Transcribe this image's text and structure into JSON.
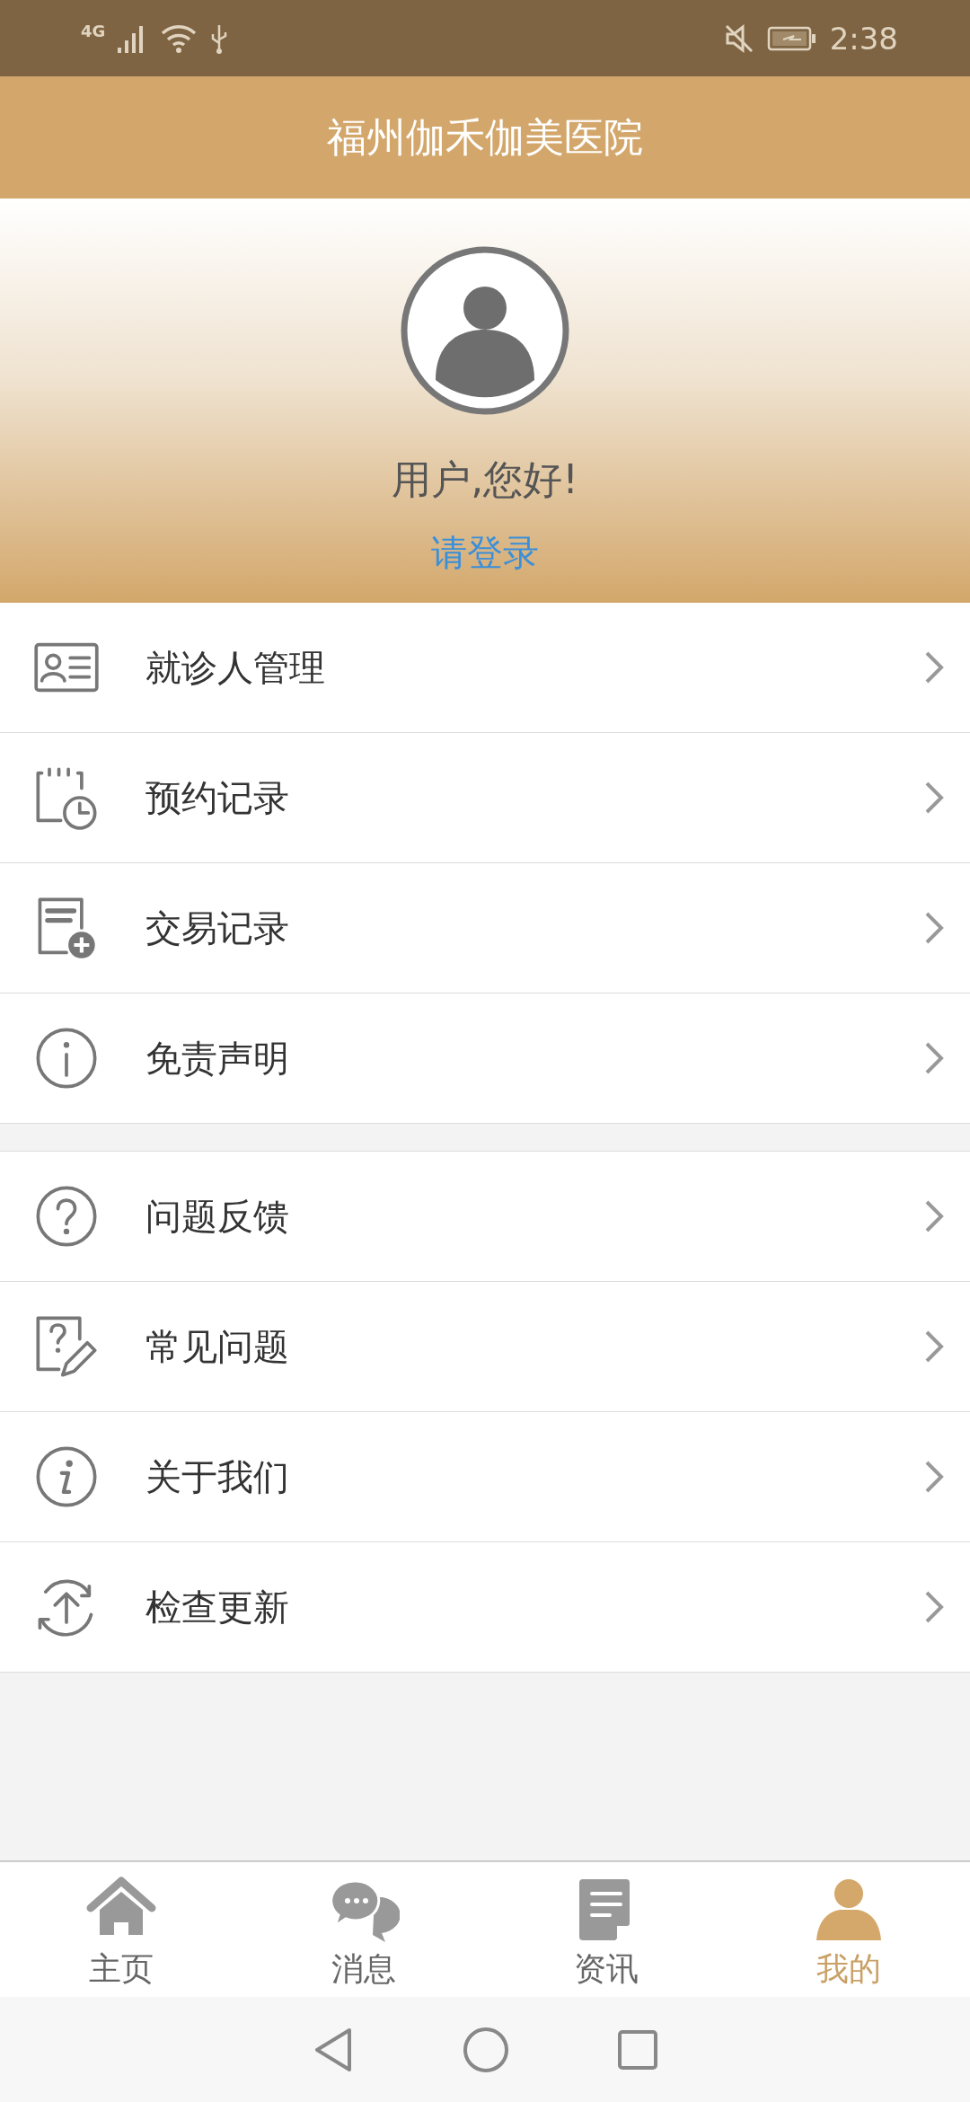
{
  "status_bar": {
    "network": "4G",
    "time": "2:38"
  },
  "header": {
    "title": "福州伽禾伽美医院"
  },
  "profile": {
    "greeting": "用户,您好!",
    "login_link": "请登录"
  },
  "menu_groups": [
    {
      "items": [
        {
          "label": "就诊人管理"
        },
        {
          "label": "预约记录"
        },
        {
          "label": "交易记录"
        },
        {
          "label": "免责声明"
        }
      ]
    },
    {
      "items": [
        {
          "label": "问题反馈"
        },
        {
          "label": "常见问题"
        },
        {
          "label": "关于我们"
        },
        {
          "label": "检查更新"
        }
      ]
    }
  ],
  "tabs": [
    {
      "label": "主页",
      "selected": false
    },
    {
      "label": "消息",
      "selected": false
    },
    {
      "label": "资讯",
      "selected": false
    },
    {
      "label": "我的",
      "selected": true
    }
  ]
}
